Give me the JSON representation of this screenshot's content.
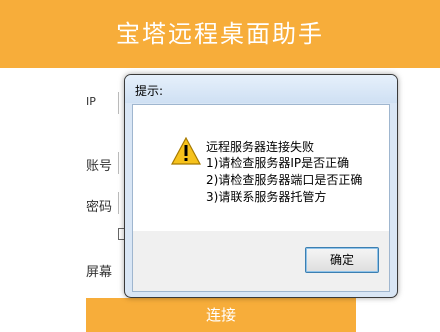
{
  "app": {
    "title": "宝塔远程桌面助手"
  },
  "form": {
    "ip_label": "IP",
    "account_label": "账号",
    "password_label": "密码",
    "screen_label": "屏幕",
    "connect_label": "连接"
  },
  "dialog": {
    "title": "提示:",
    "lines": [
      "远程服务器连接失败",
      "1)请检查服务器IP是否正确",
      "2)请检查服务器端口是否正确",
      "3)请联系服务器托管方"
    ],
    "ok_label": "确定",
    "icon": "warning-icon"
  },
  "colors": {
    "accent": "#f7ad3a",
    "dialog_border": "#3c7fb1"
  }
}
